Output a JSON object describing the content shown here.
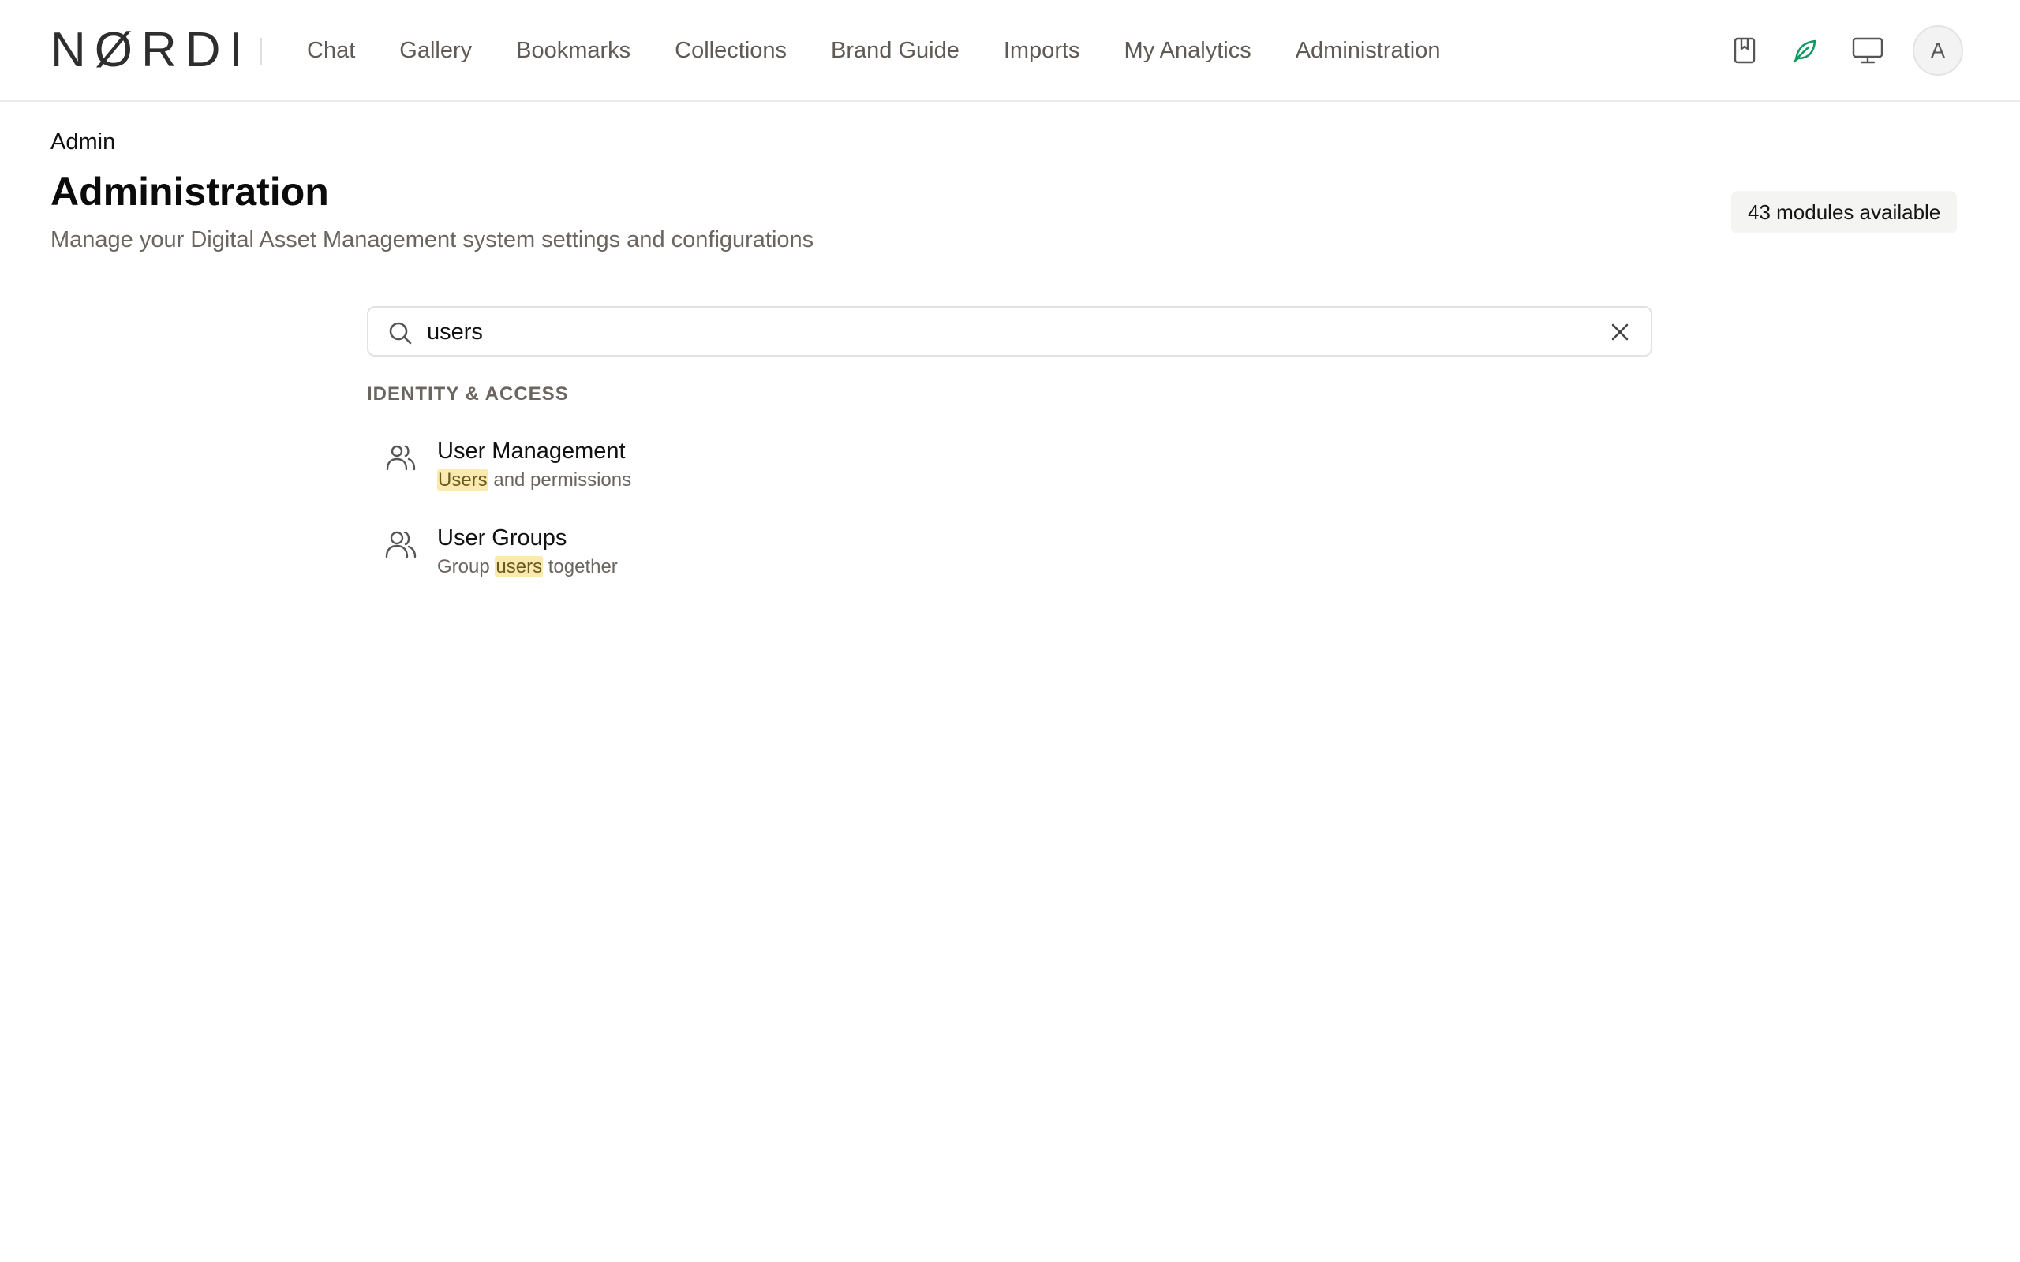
{
  "brand": {
    "logo_text": "NØRDI"
  },
  "nav": {
    "items": [
      {
        "label": "Chat"
      },
      {
        "label": "Gallery"
      },
      {
        "label": "Bookmarks"
      },
      {
        "label": "Collections"
      },
      {
        "label": "Brand Guide"
      },
      {
        "label": "Imports"
      },
      {
        "label": "My Analytics"
      },
      {
        "label": "Administration"
      }
    ]
  },
  "top_icons": {
    "bookmark": "bookmark-icon",
    "leaf": "leaf-icon",
    "monitor": "monitor-icon",
    "leaf_color": "#0f9a62"
  },
  "user": {
    "avatar_initial": "A"
  },
  "header": {
    "breadcrumb": "Admin",
    "title": "Administration",
    "subtitle": "Manage your Digital Asset Management system settings and configurations",
    "modules_badge": "43 modules available"
  },
  "search": {
    "value": "users",
    "placeholder": ""
  },
  "results": {
    "section_title": "IDENTITY & ACCESS",
    "items": [
      {
        "title": "User Management",
        "desc_highlight": "Users",
        "desc_after": " and permissions",
        "icon": "users-icon"
      },
      {
        "title": "User Groups",
        "desc_before": "Group ",
        "desc_highlight": "users",
        "desc_after": " together",
        "icon": "user-group-icon"
      }
    ]
  },
  "colors": {
    "highlight": "#fbeab0",
    "muted_text": "#6b6560"
  }
}
